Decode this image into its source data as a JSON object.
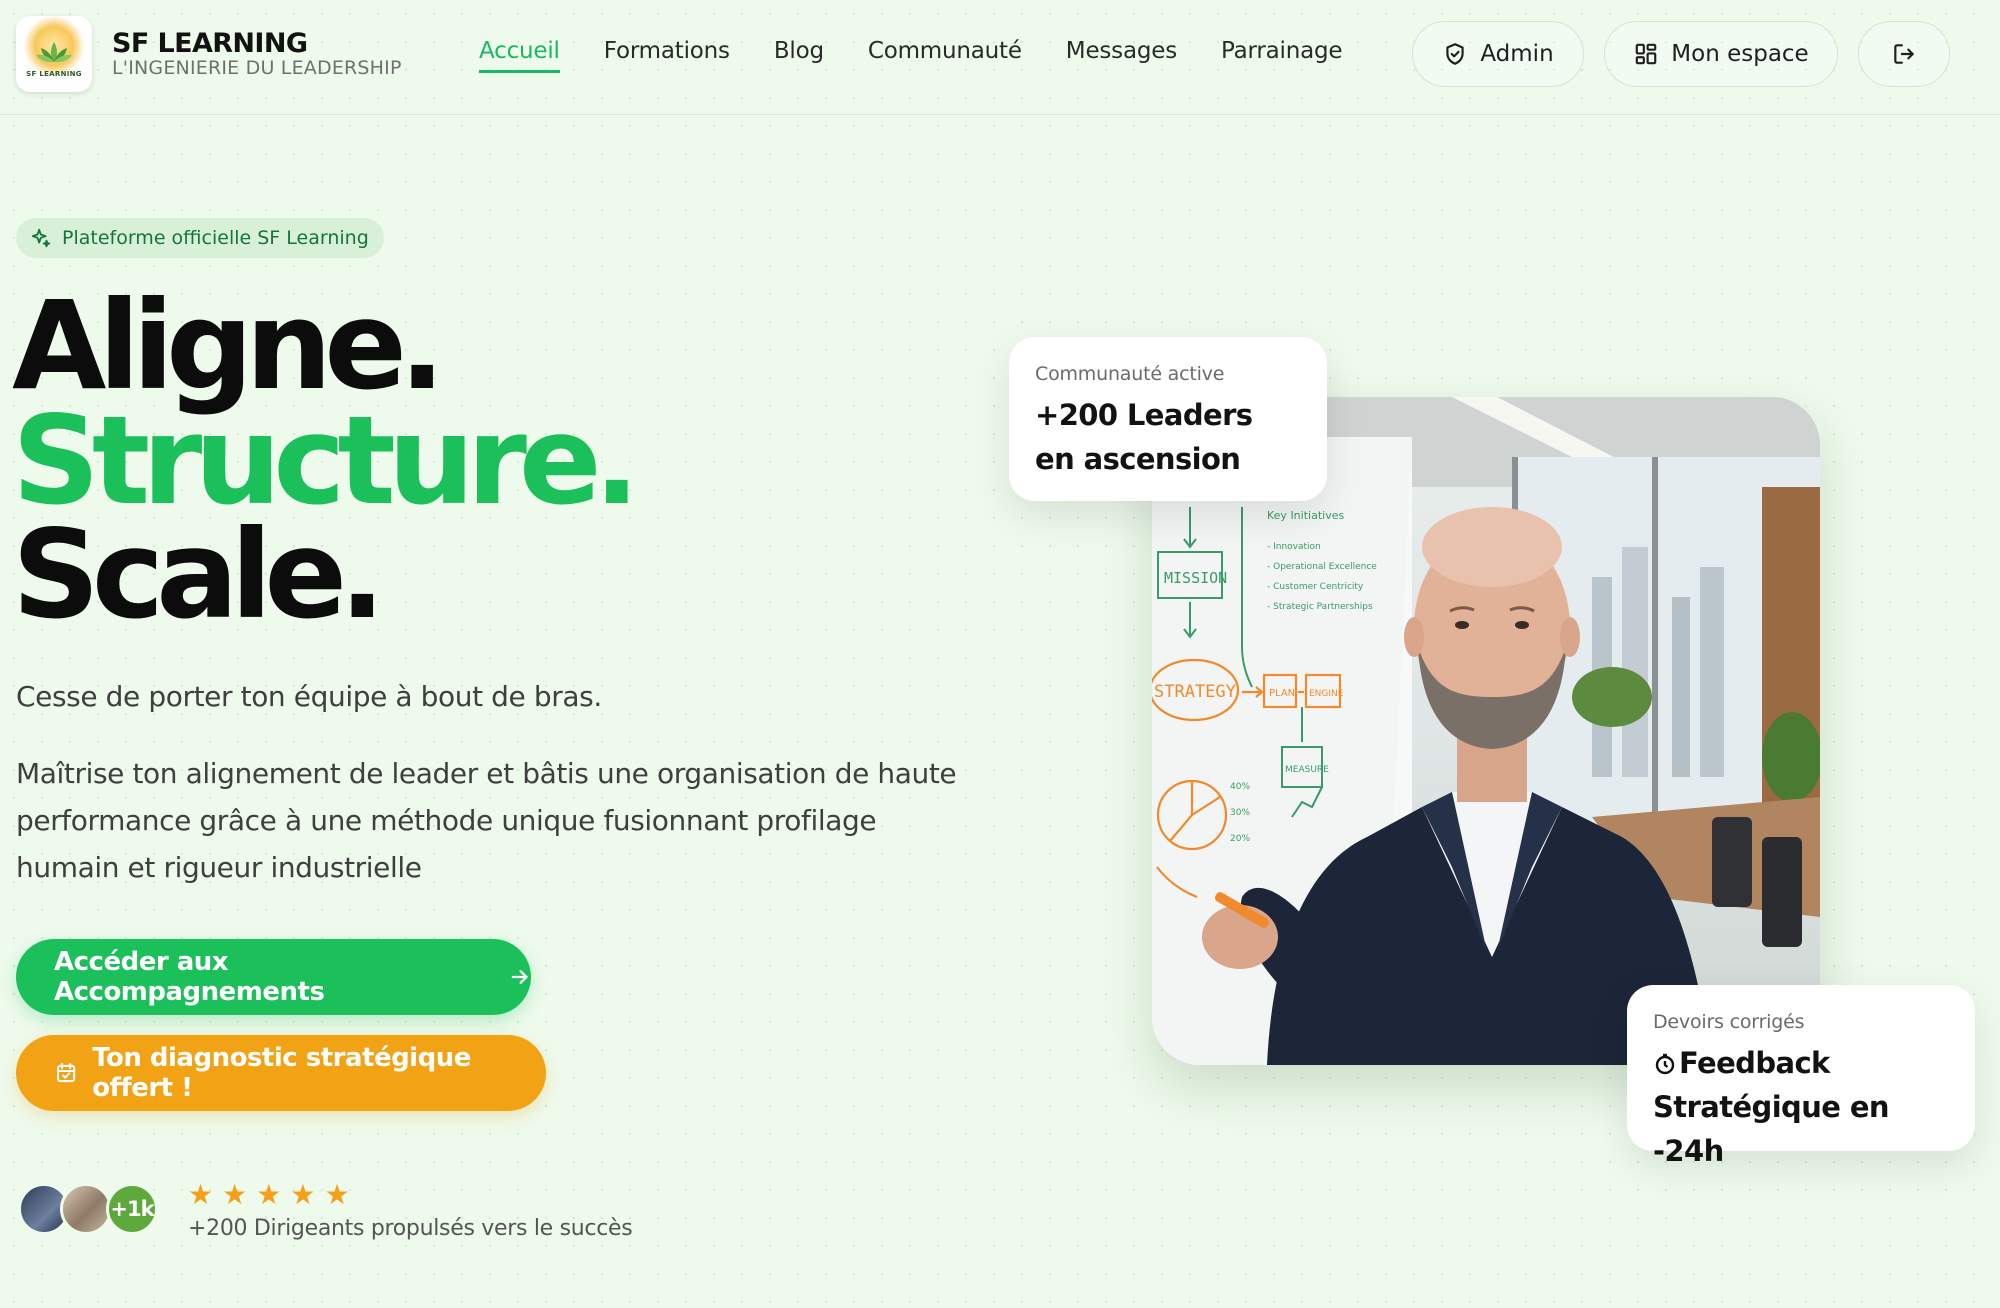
{
  "header": {
    "brand_name": "SF LEARNING",
    "brand_tagline": "L'INGENIERIE DU LEADERSHIP",
    "logo_text": "SF LEARNING",
    "nav": [
      {
        "label": "Accueil",
        "active": true
      },
      {
        "label": "Formations"
      },
      {
        "label": "Blog"
      },
      {
        "label": "Communauté"
      },
      {
        "label": "Messages"
      },
      {
        "label": "Parrainage"
      }
    ],
    "admin_label": "Admin",
    "space_label": "Mon espace"
  },
  "hero": {
    "badge": "Plateforme officielle SF Learning",
    "title_line1": "Aligne.",
    "title_line2": "Structure.",
    "title_line3": "Scale.",
    "lead1": "Cesse de porter ton équipe à bout de bras.",
    "lead2": "Maîtrise ton alignement de leader et bâtis une organisation de haute performance grâce à une méthode unique fusionnant profilage humain et rigueur industrielle",
    "cta_primary": "Accéder aux Accompagnements",
    "cta_secondary": "Ton diagnostic stratégique offert !",
    "avatar_badge": "+1k",
    "stars": [
      "★",
      "★",
      "★",
      "★",
      "★"
    ],
    "social_proof": "+200 Dirigeants propulsés vers le succès"
  },
  "whiteboard": {
    "mission": "MISSION",
    "strategy": "STRATEGY",
    "plan": "PLAN",
    "engine": "ENGINE",
    "measure": "MEASURE",
    "key_initiatives": "Key Initiatives",
    "bullets": [
      "- Innovation",
      "- Operational Excellence",
      "- Customer Centricity",
      "- Strategic Partnerships"
    ],
    "percents": [
      "40%",
      "30%",
      "20%"
    ]
  },
  "cards": {
    "community_small": "Communauté active",
    "community_big": "+200 Leaders en ascension",
    "feedback_small": "Devoirs corrigés",
    "feedback_big": "Feedback Stratégique en -24h"
  },
  "colors": {
    "accent_green": "#1bc05a",
    "accent_orange": "#f2a215",
    "background": "#eefaec",
    "star": "#f5a01a"
  },
  "icons": {
    "admin": "shield-icon",
    "space": "grid-icon",
    "logout": "logout-icon",
    "badge": "sparkle-icon",
    "cta_primary": "arrow-right-icon",
    "cta_secondary": "calendar-icon",
    "feedback": "clock-icon"
  }
}
